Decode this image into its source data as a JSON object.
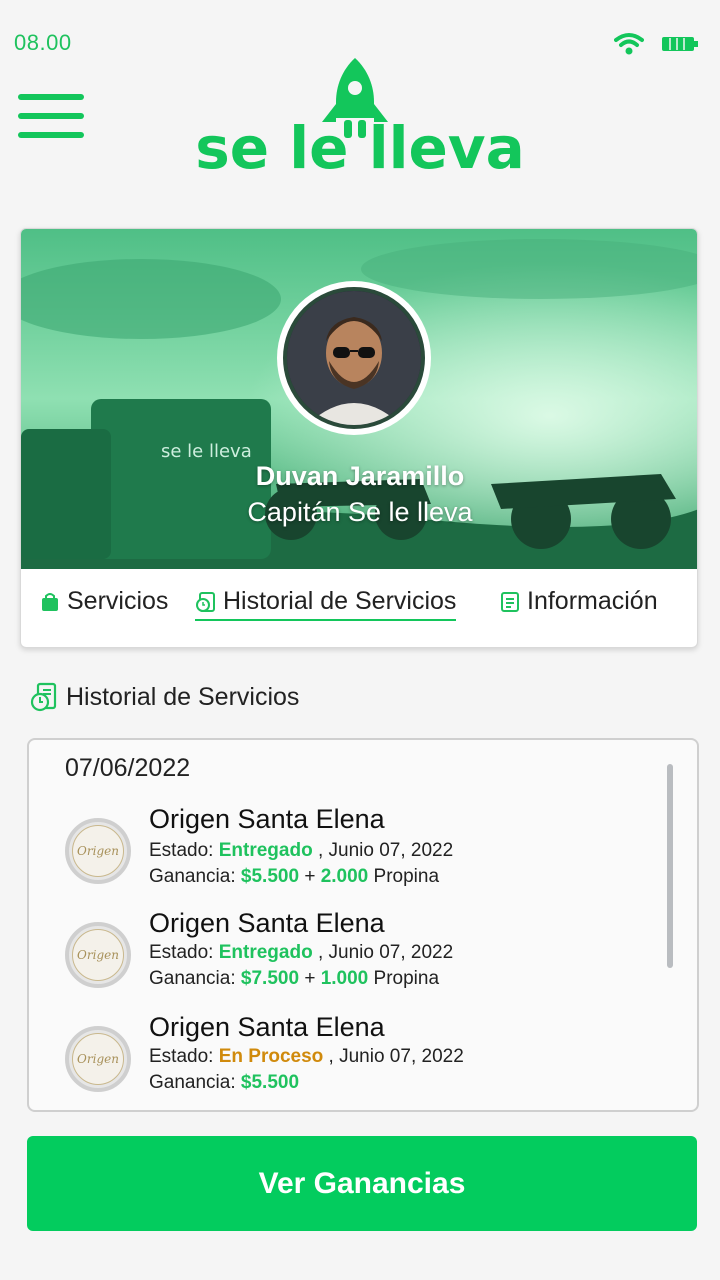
{
  "status_bar": {
    "time": "08.00",
    "wifi_icon": "wifi-icon",
    "battery_icon": "battery-icon"
  },
  "header": {
    "menu_icon": "hamburger-menu-icon",
    "logo_text": "se le lleva"
  },
  "profile": {
    "name": "Duvan Jaramillo",
    "role": "Capitán Se le lleva",
    "cover_bag_text": "se le lleva"
  },
  "tabs": [
    {
      "label": "Servicios",
      "icon": "shopping-bag-icon",
      "active": false
    },
    {
      "label": "Historial de Servicios",
      "icon": "history-icon",
      "active": true
    },
    {
      "label": "Información",
      "icon": "document-icon",
      "active": false
    }
  ],
  "section": {
    "title": "Historial de Servicios",
    "icon": "history-icon"
  },
  "history": {
    "date": "07/06/2022",
    "items": [
      {
        "name": "Origen Santa Elena",
        "estado_label": "Estado:",
        "estado": "Entregado",
        "fecha": ", Junio 07, 2022",
        "ganancia_label": "Ganancia:",
        "ganancia": "$5.500",
        "plus": "+",
        "propina": "2.000",
        "propina_label": "Propina",
        "logo_text": "Origen"
      },
      {
        "name": "Origen Santa Elena",
        "estado_label": "Estado:",
        "estado": "Entregado",
        "fecha": ", Junio 07, 2022",
        "ganancia_label": "Ganancia:",
        "ganancia": "$7.500",
        "plus": "+",
        "propina": "1.000",
        "propina_label": "Propina",
        "logo_text": "Origen"
      },
      {
        "name": "Origen Santa Elena",
        "estado_label": "Estado:",
        "estado": "En Proceso",
        "fecha": ", Junio 07, 2022",
        "ganancia_label": "Ganancia:",
        "ganancia": "$5.500",
        "logo_text": "Origen"
      }
    ]
  },
  "cta": {
    "label": "Ver Ganancias"
  },
  "colors": {
    "brand_green": "#13c65b",
    "cta_green": "#03cc5e",
    "status_orange": "#d08a0c"
  }
}
